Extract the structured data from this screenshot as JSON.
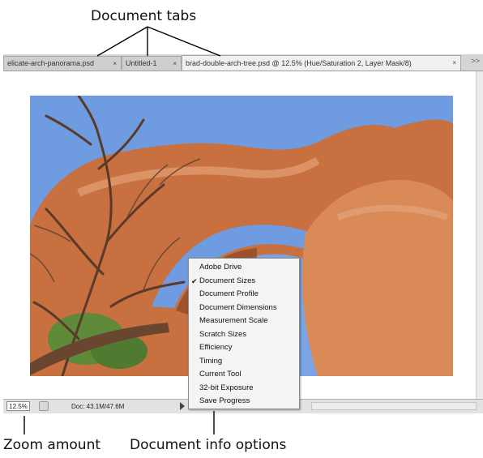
{
  "callouts": {
    "tabs": "Document tabs",
    "zoom": "Zoom amount",
    "info": "Document info options"
  },
  "tabs": [
    {
      "label": "elicate-arch-panorama.psd",
      "close": "×",
      "active": false
    },
    {
      "label": "Untitled-1",
      "close": "×",
      "active": false
    },
    {
      "label": "brad-double-arch-tree.psd @ 12.5% (Hue/Saturation 2, Layer Mask/8)",
      "close": "×",
      "active": true
    }
  ],
  "tabs_overflow": ">>",
  "status": {
    "zoom": "12.5%",
    "doc_size": "Doc: 43.1M/47.6M"
  },
  "menu": {
    "items": [
      {
        "label": "Adobe Drive",
        "checked": false
      },
      {
        "label": "Document Sizes",
        "checked": true
      },
      {
        "label": "Document Profile",
        "checked": false
      },
      {
        "label": "Document Dimensions",
        "checked": false
      },
      {
        "label": "Measurement Scale",
        "checked": false
      },
      {
        "label": "Scratch Sizes",
        "checked": false
      },
      {
        "label": "Efficiency",
        "checked": false
      },
      {
        "label": "Timing",
        "checked": false
      },
      {
        "label": "Current Tool",
        "checked": false
      },
      {
        "label": "32-bit Exposure",
        "checked": false
      },
      {
        "label": "Save Progress",
        "checked": false
      }
    ],
    "check_glyph": "✔"
  },
  "colors": {
    "sky": "#6f9be0",
    "rock": "#c8703f",
    "rock_light": "#e3a277",
    "foliage": "#5f8a3a"
  }
}
